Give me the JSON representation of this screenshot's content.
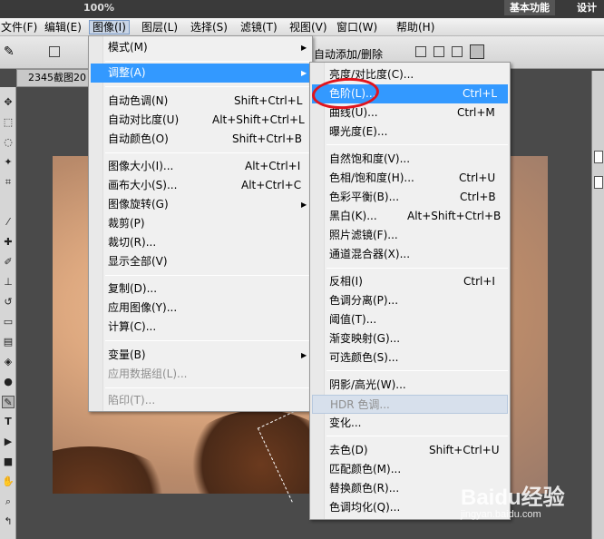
{
  "menubar": {
    "items": [
      "文件(F)",
      "编辑(E)",
      "图像(I)",
      "图层(L)",
      "选择(S)",
      "滤镜(T)",
      "视图(V)",
      "窗口(W)",
      "帮助(H)"
    ]
  },
  "topbar": {
    "zoom": "100%",
    "workspace": "基本功能",
    "design": "设计"
  },
  "options": {
    "auto_add_delete": "自动添加/删除"
  },
  "document_tab": {
    "label": "2345截图20"
  },
  "image_menu": {
    "items": [
      {
        "label": "模式(M)",
        "shortcut": ""
      },
      {
        "label": "调整(A)",
        "shortcut": ""
      },
      {
        "label": "自动色调(N)",
        "shortcut": "Shift+Ctrl+L"
      },
      {
        "label": "自动对比度(U)",
        "shortcut": "Alt+Shift+Ctrl+L"
      },
      {
        "label": "自动颜色(O)",
        "shortcut": "Shift+Ctrl+B"
      },
      {
        "label": "图像大小(I)...",
        "shortcut": "Alt+Ctrl+I"
      },
      {
        "label": "画布大小(S)...",
        "shortcut": "Alt+Ctrl+C"
      },
      {
        "label": "图像旋转(G)",
        "shortcut": ""
      },
      {
        "label": "裁剪(P)",
        "shortcut": ""
      },
      {
        "label": "裁切(R)...",
        "shortcut": ""
      },
      {
        "label": "显示全部(V)",
        "shortcut": ""
      },
      {
        "label": "复制(D)...",
        "shortcut": ""
      },
      {
        "label": "应用图像(Y)...",
        "shortcut": ""
      },
      {
        "label": "计算(C)...",
        "shortcut": ""
      },
      {
        "label": "变量(B)",
        "shortcut": ""
      },
      {
        "label": "应用数据组(L)...",
        "shortcut": ""
      },
      {
        "label": "陷印(T)...",
        "shortcut": ""
      }
    ]
  },
  "adjust_menu": {
    "items": [
      {
        "label": "亮度/对比度(C)...",
        "shortcut": ""
      },
      {
        "label": "色阶(L)...",
        "shortcut": "Ctrl+L"
      },
      {
        "label": "曲线(U)...",
        "shortcut": "Ctrl+M"
      },
      {
        "label": "曝光度(E)...",
        "shortcut": ""
      },
      {
        "label": "自然饱和度(V)...",
        "shortcut": ""
      },
      {
        "label": "色相/饱和度(H)...",
        "shortcut": "Ctrl+U"
      },
      {
        "label": "色彩平衡(B)...",
        "shortcut": "Ctrl+B"
      },
      {
        "label": "黑白(K)...",
        "shortcut": "Alt+Shift+Ctrl+B"
      },
      {
        "label": "照片滤镜(F)...",
        "shortcut": ""
      },
      {
        "label": "通道混合器(X)...",
        "shortcut": ""
      },
      {
        "label": "反相(I)",
        "shortcut": "Ctrl+I"
      },
      {
        "label": "色调分离(P)...",
        "shortcut": ""
      },
      {
        "label": "阈值(T)...",
        "shortcut": ""
      },
      {
        "label": "渐变映射(G)...",
        "shortcut": ""
      },
      {
        "label": "可选颜色(S)...",
        "shortcut": ""
      },
      {
        "label": "阴影/高光(W)...",
        "shortcut": ""
      },
      {
        "label": "HDR 色调...",
        "shortcut": ""
      },
      {
        "label": "变化...",
        "shortcut": ""
      },
      {
        "label": "去色(D)",
        "shortcut": "Shift+Ctrl+U"
      },
      {
        "label": "匹配颜色(M)...",
        "shortcut": ""
      },
      {
        "label": "替换颜色(R)...",
        "shortcut": ""
      },
      {
        "label": "色调均化(Q)...",
        "shortcut": ""
      }
    ]
  },
  "watermark": {
    "main": "Baidu经验",
    "sub": "jingyan.baidu.com"
  },
  "colors": {
    "highlight": "#3399ff",
    "annotation": "#e0141d"
  }
}
